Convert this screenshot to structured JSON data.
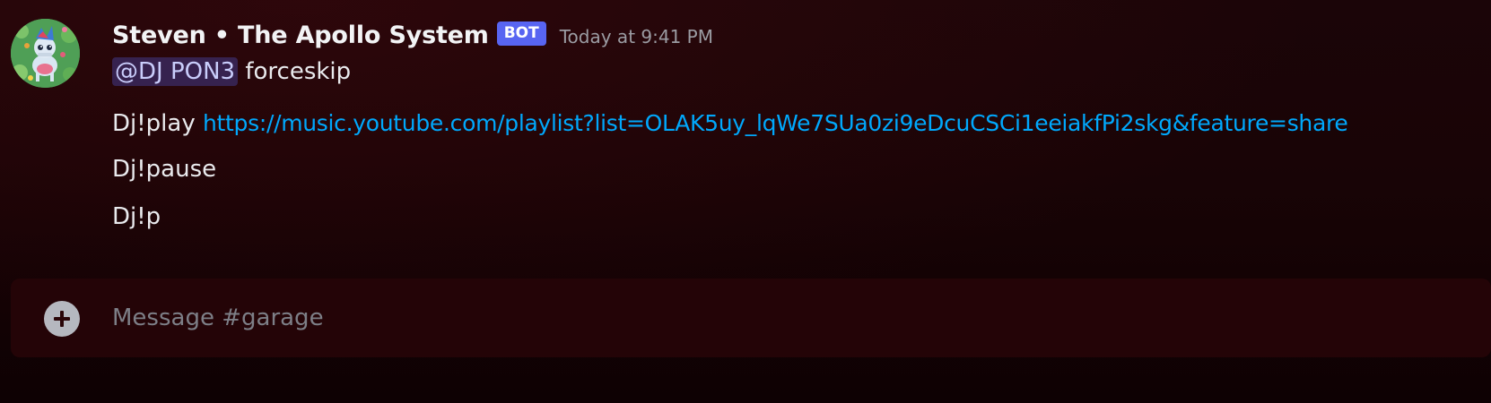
{
  "message": {
    "author": "Steven • The Apollo System",
    "bot_tag": "BOT",
    "timestamp": "Today at 9:41 PM",
    "avatar_icon": "pony-avatar-icon",
    "lines": [
      {
        "mention": "@DJ PON3",
        "text": " forceskip"
      },
      {
        "text": "Dj!play ",
        "link": "https://music.youtube.com/playlist?list=OLAK5uy_lqWe7SUa0zi9eDcuCSCi1eeiakfPi2skg&feature=share"
      },
      {
        "text": "Dj!pause"
      },
      {
        "text": "Dj!p"
      }
    ]
  },
  "composer": {
    "placeholder": "Message #garage",
    "value": "",
    "add_icon": "plus-circle-icon"
  },
  "colors": {
    "background": "#190406",
    "bot_tag": "#5865f2",
    "link": "#00a8fc",
    "mention_bg": "#3a3a6a",
    "composer_bg": "#240407"
  }
}
